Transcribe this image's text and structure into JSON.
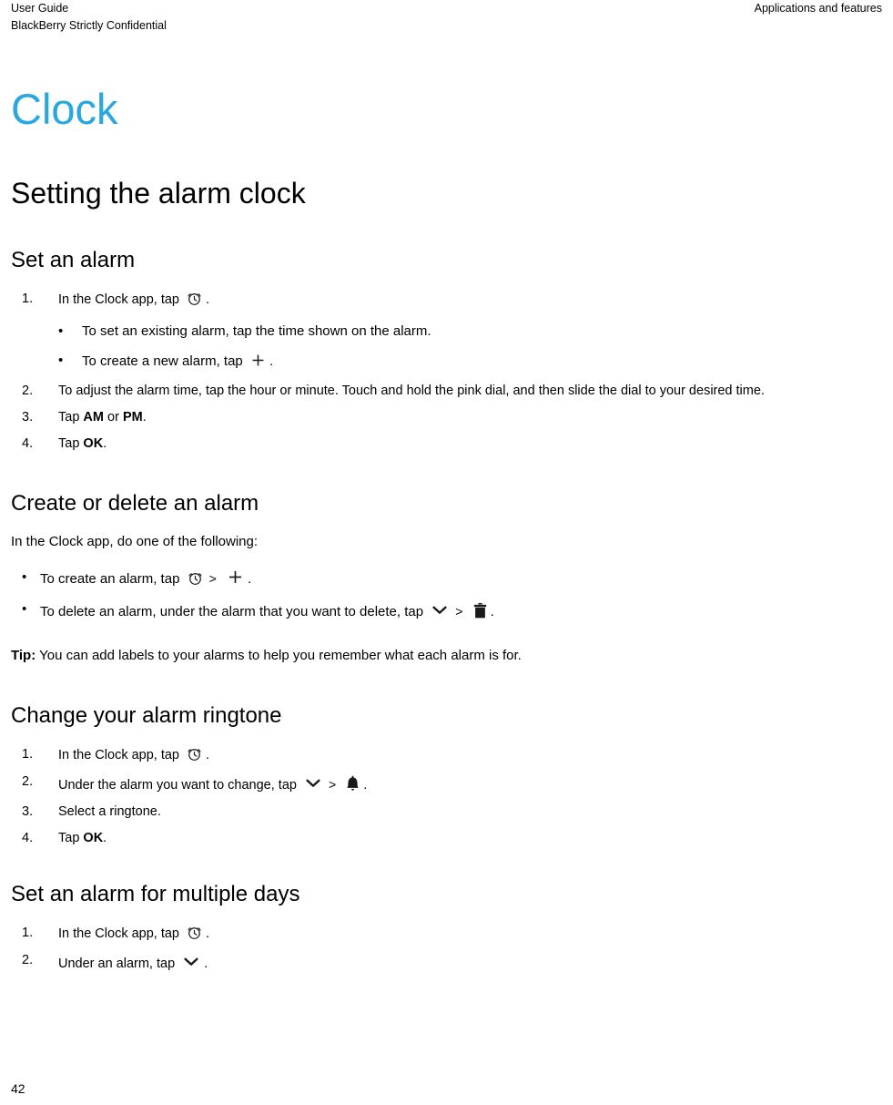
{
  "document": {
    "running_header": {
      "left_line1": "User Guide",
      "left_line2": "BlackBerry Strictly Confidential",
      "right": "Applications and features"
    },
    "chapter_title": "Clock",
    "page_number": "42",
    "accent_color": "#29a8e0"
  },
  "sections": {
    "setting_the_alarm_clock": {
      "heading": "Setting the alarm clock",
      "subsection": {
        "heading": "Set an alarm",
        "steps": [
          {
            "num": "1.",
            "text_before": "In the Clock app, tap",
            "icon": "alarm-clock-icon",
            "text_after": ".",
            "subbullets": [
              {
                "bullet": "•",
                "text": "To set an existing alarm, tap the time shown on the alarm."
              },
              {
                "bullet": "•",
                "text_before": "To create a new alarm, tap",
                "icon": "plus-icon",
                "text_after": "."
              }
            ]
          },
          {
            "num": "2.",
            "text": "To adjust the alarm time, tap the hour or minute. Touch and hold the pink dial, and then slide the dial to your desired time."
          },
          {
            "num": "3.",
            "text_pre": "Tap ",
            "bold1": "AM",
            "text_mid": " or ",
            "bold2": "PM",
            "text_post": "."
          },
          {
            "num": "4.",
            "text_pre": "Tap ",
            "bold1": "OK",
            "text_post": "."
          }
        ]
      }
    },
    "create_or_delete_an_alarm": {
      "heading": "Create or delete an alarm",
      "intro": "In the Clock app, do one of the following:",
      "bullets": [
        {
          "bullet": "•",
          "text_before": "To create an alarm, tap",
          "icon1": "alarm-clock-icon",
          "separator": ">",
          "icon2": "plus-icon",
          "text_after": "."
        },
        {
          "bullet": "•",
          "text_before": "To delete an alarm, under the alarm that you want to delete, tap",
          "icon1": "chevron-down-icon",
          "separator": ">",
          "icon2": "trash-icon",
          "text_after": "."
        }
      ],
      "tip_label": "Tip:",
      "tip_text": " You can add labels to your alarms to help you remember what each alarm is for."
    },
    "change_your_alarm_ringtone": {
      "heading": "Change your alarm ringtone",
      "steps": [
        {
          "num": "1.",
          "text_before": "In the Clock app, tap",
          "icon": "alarm-clock-icon",
          "text_after": "."
        },
        {
          "num": "2.",
          "text_before": "Under the alarm you want to change, tap",
          "icon1": "chevron-down-icon",
          "separator": ">",
          "icon2": "bell-icon",
          "text_after": "."
        },
        {
          "num": "3.",
          "text": "Select a ringtone."
        },
        {
          "num": "4.",
          "text_pre": "Tap ",
          "bold1": "OK",
          "text_post": "."
        }
      ]
    },
    "set_an_alarm_for_multiple_days": {
      "heading": "Set an alarm for multiple days",
      "steps": [
        {
          "num": "1.",
          "text_before": "In the Clock app, tap",
          "icon": "alarm-clock-icon",
          "text_after": "."
        },
        {
          "num": "2.",
          "text_before": "Under an alarm, tap",
          "icon": "chevron-down-icon",
          "text_after": "."
        }
      ]
    }
  }
}
